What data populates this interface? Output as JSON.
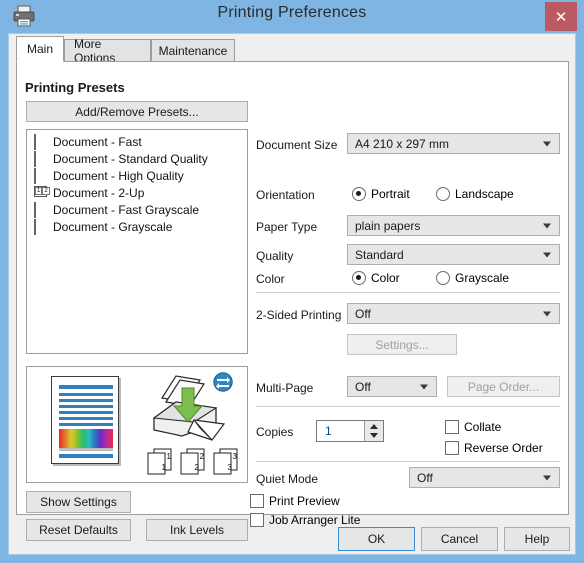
{
  "window": {
    "title": "Printing Preferences",
    "printer_icon": "printer-icon",
    "close_label": "✕",
    "close_color": "#bc5a62",
    "titlebar_color": "#7fb5e2"
  },
  "tabs": [
    {
      "label": "Main",
      "active": true
    },
    {
      "label": "More Options",
      "active": false
    },
    {
      "label": "Maintenance",
      "active": false
    }
  ],
  "presets": {
    "heading": "Printing Presets",
    "add_remove_label": "Add/Remove Presets...",
    "items": [
      {
        "label": "Document - Fast",
        "icon": "document-fast-icon"
      },
      {
        "label": "Document - Standard Quality",
        "icon": "document-standard-quality-icon"
      },
      {
        "label": "Document - High Quality",
        "icon": "document-high-quality-icon"
      },
      {
        "label": "Document - 2-Up",
        "icon": "document-2up-icon"
      },
      {
        "label": "Document - Fast Grayscale",
        "icon": "document-fast-grayscale-icon"
      },
      {
        "label": "Document - Grayscale",
        "icon": "document-grayscale-icon"
      }
    ]
  },
  "preview": {
    "page_thumbnails": [
      "1",
      "2",
      "3"
    ],
    "duplex_badge": "duplex-icon",
    "printer_graphic": "printer-preview-icon"
  },
  "left_buttons": {
    "show_settings": "Show Settings",
    "reset_defaults": "Reset Defaults",
    "ink_levels": "Ink Levels"
  },
  "settings": {
    "document_size": {
      "label": "Document Size",
      "value": "A4 210 x 297 mm"
    },
    "orientation": {
      "label": "Orientation",
      "options": [
        {
          "label": "Portrait",
          "checked": true
        },
        {
          "label": "Landscape",
          "checked": false
        }
      ]
    },
    "paper_type": {
      "label": "Paper Type",
      "value": "plain papers"
    },
    "quality": {
      "label": "Quality",
      "value": "Standard"
    },
    "color": {
      "label": "Color",
      "options": [
        {
          "label": "Color",
          "checked": true
        },
        {
          "label": "Grayscale",
          "checked": false
        }
      ]
    },
    "two_sided": {
      "label": "2-Sided Printing",
      "value": "Off",
      "settings_button": "Settings..."
    },
    "multi_page": {
      "label": "Multi-Page",
      "value": "Off",
      "page_order_button": "Page Order..."
    },
    "copies": {
      "label": "Copies",
      "value": "1",
      "collate": {
        "label": "Collate",
        "checked": false
      },
      "reverse_order": {
        "label": "Reverse Order",
        "checked": false
      }
    },
    "quiet_mode": {
      "label": "Quiet Mode",
      "value": "Off"
    },
    "print_preview": {
      "label": "Print Preview",
      "checked": false
    },
    "job_arranger": {
      "label": "Job Arranger Lite",
      "checked": false
    }
  },
  "footer": {
    "ok": "OK",
    "cancel": "Cancel",
    "help": "Help"
  }
}
